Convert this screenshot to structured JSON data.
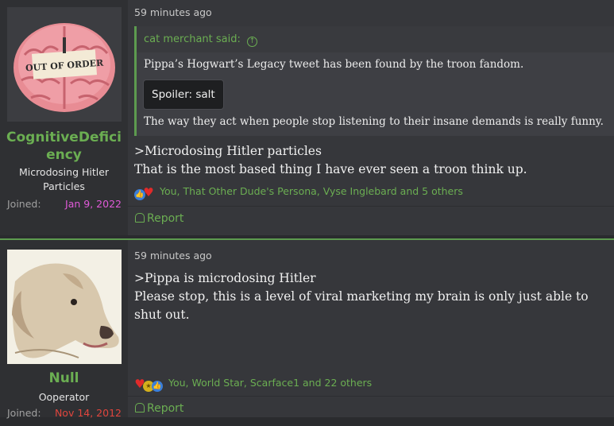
{
  "posts": [
    {
      "user": {
        "name": "CognitiveDeficiency",
        "title": "Microdosing Hitler Particles",
        "joined_label": "Joined:",
        "joined_date": "Jan 9, 2022",
        "avatar_sign": "OUT OF ORDER"
      },
      "time": "59 minutes ago",
      "quote": {
        "author": "cat merchant said:",
        "line1": "Pippa’s Hogwart’s Legacy tweet has been found by the troon fandom.",
        "spoiler": "Spoiler: salt",
        "line2": "The way they act when people stop listening to their insane demands is really funny."
      },
      "body": [
        ">Microdosing Hitler particles",
        "That is the most based thing I have ever seen a troon think up."
      ],
      "reactions": "You, That Other Dude's Persona, Vyse Inglebard and 5 others",
      "report_label": "Report"
    },
    {
      "user": {
        "name": "Null",
        "title": "Ooperator",
        "joined_label": "Joined:",
        "joined_date": "Nov 14, 2012"
      },
      "time": "59 minutes ago",
      "body": [
        ">Pippa is microdosing Hitler",
        "Please stop, this is a level of viral marketing my brain is only just able to shut out."
      ],
      "reactions": "You, World Star, Scarface1 and 22 others",
      "report_label": "Report"
    }
  ],
  "colors": {
    "accent_green": "#6bae52",
    "joined_date_1": "#e05ad8",
    "joined_date_2": "#e0453d"
  }
}
